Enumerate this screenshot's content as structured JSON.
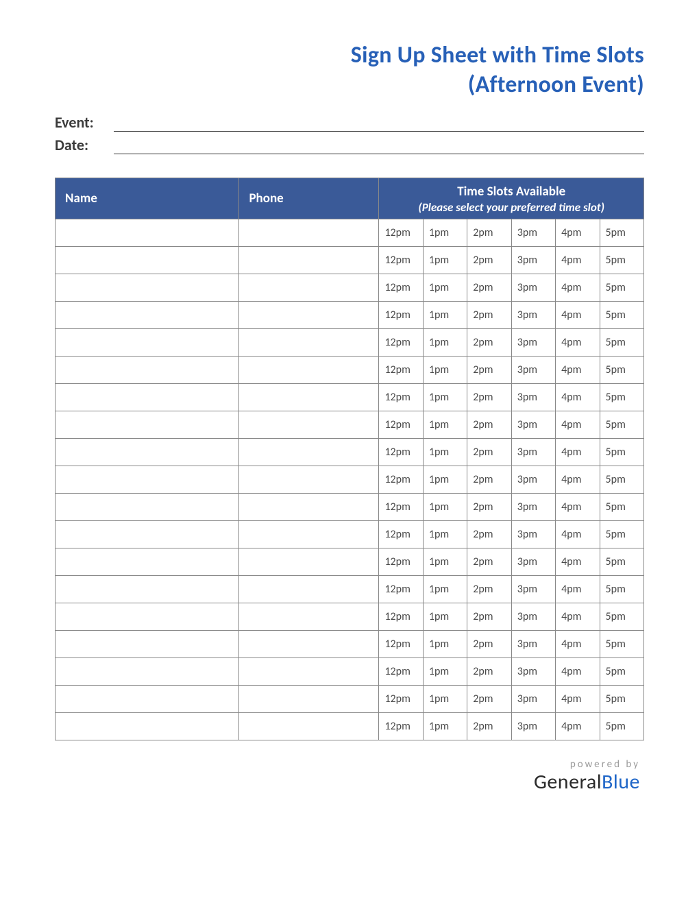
{
  "title_line1": "Sign Up Sheet with Time  Slots",
  "title_line2": "(Afternoon Event)",
  "meta": {
    "event_label": "Event:",
    "event_value": "",
    "date_label": "Date:",
    "date_value": ""
  },
  "headers": {
    "name": "Name",
    "phone": "Phone",
    "slots_title": "Time Slots Available",
    "slots_subtitle": "(Please select your preferred time slot)"
  },
  "time_slots": [
    "12pm",
    "1pm",
    "2pm",
    "3pm",
    "4pm",
    "5pm"
  ],
  "row_count": 19,
  "footer": {
    "powered_by": "powered by",
    "brand_general": "General",
    "brand_blue": "Blue"
  },
  "colors": {
    "header_bg": "#3a5a98",
    "title": "#2760b7",
    "brand_blue": "#1f66c8"
  }
}
